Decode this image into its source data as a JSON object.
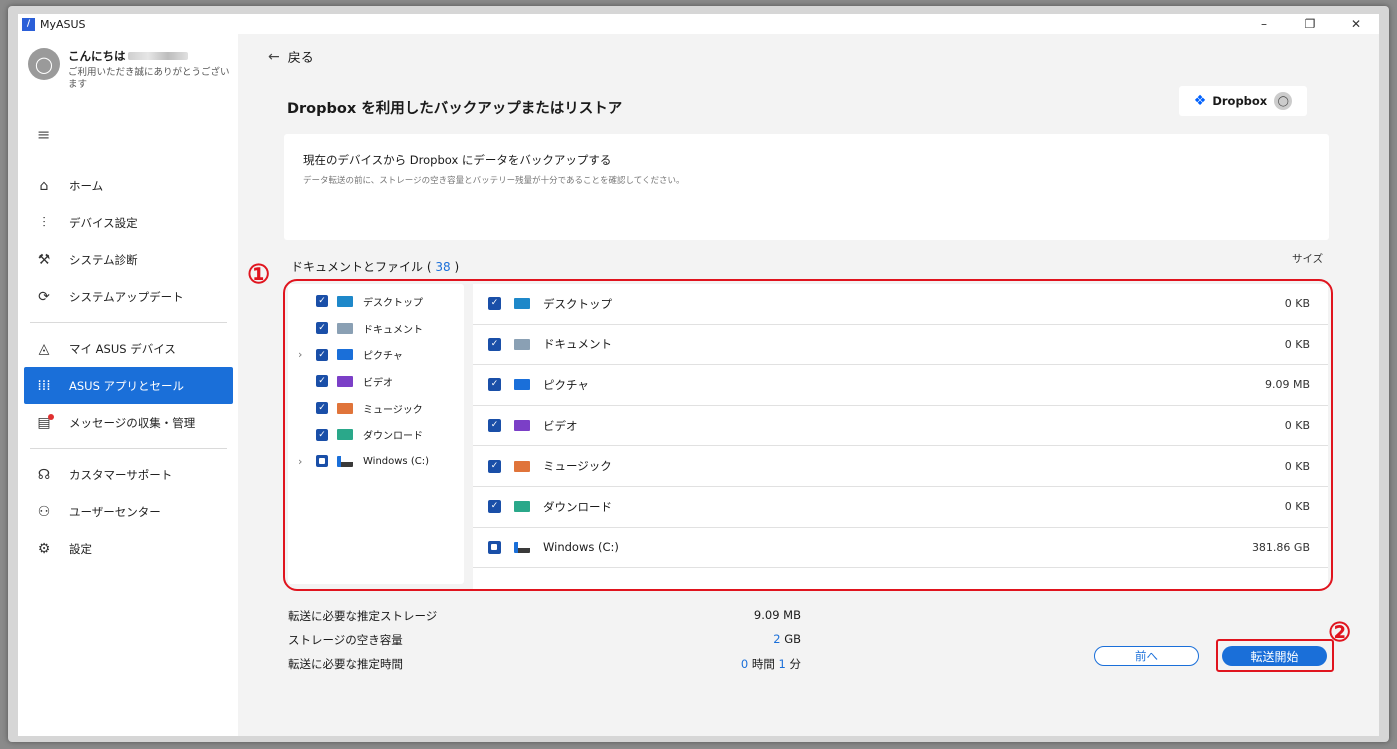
{
  "window": {
    "title": "MyASUS",
    "logo_text": "/",
    "controls": [
      "–",
      "❐",
      "✕"
    ]
  },
  "user": {
    "greeting": "こんにちは",
    "subtitle": "ご利用いただき誠にありがとうございます"
  },
  "nav": {
    "group1": [
      {
        "label": "ホーム",
        "icon": "⌂"
      },
      {
        "label": "デバイス設定",
        "icon": "⫶"
      },
      {
        "label": "システム診断",
        "icon": "⚒"
      },
      {
        "label": "システムアップデート",
        "icon": "⟳"
      }
    ],
    "group2": [
      {
        "label": "マイ ASUS デバイス",
        "icon": "◬"
      },
      {
        "label": "ASUS アプリとセール",
        "icon": "⁞⁞⁞"
      },
      {
        "label": "メッセージの収集・管理",
        "icon": "▤"
      }
    ],
    "group3": [
      {
        "label": "カスタマーサポート",
        "icon": "☊"
      },
      {
        "label": "ユーザーセンター",
        "icon": "⚇"
      },
      {
        "label": "設定",
        "icon": "⚙"
      }
    ]
  },
  "main": {
    "back_label": "戻る",
    "page_title": "Dropbox を利用したバックアップまたはリストア",
    "dropbox_label": "Dropbox",
    "info_title": "現在のデバイスから Dropbox にデータをバックアップする",
    "info_desc": "データ転送の前に、ストレージの空き容量とバッテリー残量が十分であることを確認してください。",
    "docs_label_prefix": "ドキュメントとファイル (",
    "docs_count": "38",
    "docs_label_suffix": ")",
    "size_header": "サイズ"
  },
  "tree": [
    {
      "label": "デスクトップ",
      "expandable": false
    },
    {
      "label": "ドキュメント",
      "expandable": false
    },
    {
      "label": "ピクチャ",
      "expandable": true
    },
    {
      "label": "ビデオ",
      "expandable": false
    },
    {
      "label": "ミュージック",
      "expandable": false
    },
    {
      "label": "ダウンロード",
      "expandable": false
    },
    {
      "label": "Windows (C:)",
      "expandable": true
    }
  ],
  "files": [
    {
      "name": "デスクトップ",
      "size": "0 KB",
      "color": "#1e88c9"
    },
    {
      "name": "ドキュメント",
      "size": "0 KB",
      "color": "#8aa0b4"
    },
    {
      "name": "ピクチャ",
      "size": "9.09 MB",
      "color": "#1a6fd9"
    },
    {
      "name": "ビデオ",
      "size": "0 KB",
      "color": "#7b3fc7"
    },
    {
      "name": "ミュージック",
      "size": "0 KB",
      "color": "#e0743a"
    },
    {
      "name": "ダウンロード",
      "size": "0 KB",
      "color": "#2aa88a"
    },
    {
      "name": "Windows (C:)",
      "size": "381.86 GB",
      "color": "#3a3a3a"
    }
  ],
  "summary": {
    "est_storage_label": "転送に必要な推定ストレージ",
    "est_storage_value": "9.09 MB",
    "free_label": "ストレージの空き容量",
    "free_value_num": "2",
    "free_value_unit": "GB",
    "est_time_label": "転送に必要な推定時間",
    "est_time_h": "0",
    "est_time_h_unit": "時間",
    "est_time_m": "1",
    "est_time_m_unit": "分"
  },
  "buttons": {
    "prev": "前へ",
    "start": "転送開始"
  },
  "annotations": {
    "one": "①",
    "two": "②"
  },
  "colors": {
    "accent": "#1a6fd9",
    "annotation": "#e0141e"
  }
}
